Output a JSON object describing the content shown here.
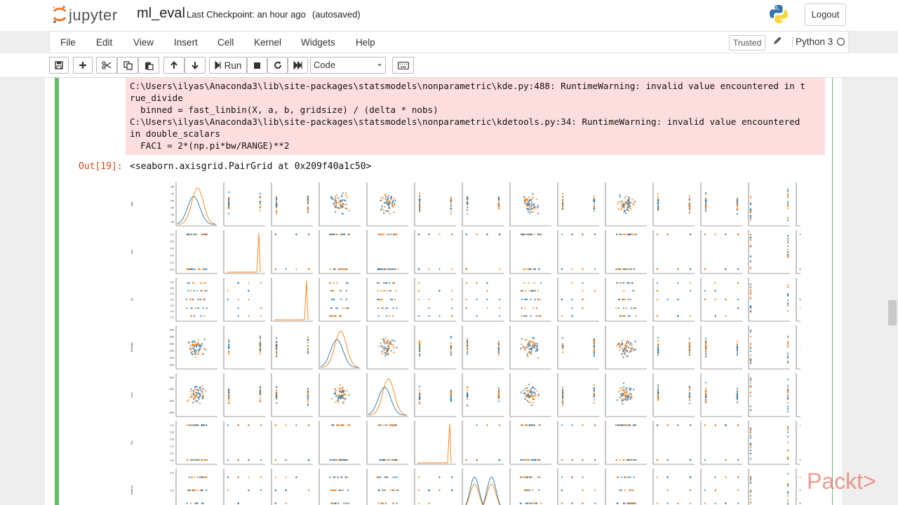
{
  "header": {
    "brand": "jupyter",
    "notebook_name": "ml_eval",
    "checkpoint": "Last Checkpoint: an hour ago",
    "autosave": "(autosaved)",
    "logout": "Logout"
  },
  "menubar": {
    "items": [
      "File",
      "Edit",
      "View",
      "Insert",
      "Cell",
      "Kernel",
      "Widgets",
      "Help"
    ],
    "trusted": "Trusted",
    "kernel": "Python 3"
  },
  "toolbar": {
    "run_label": "Run",
    "cell_type": "Code",
    "buttons": [
      "save-icon",
      "plus-icon",
      "scissors-icon",
      "copy-icon",
      "paste-icon",
      "arrow-up-icon",
      "arrow-down-icon",
      "run-icon",
      "stop-icon",
      "restart-icon",
      "fast-forward-icon",
      "keyboard-icon"
    ]
  },
  "cell": {
    "stderr_lines": [
      "C:\\Users\\ilyas\\Anaconda3\\lib\\site-packages\\statsmodels\\nonparametric\\kde.py:488: RuntimeWarning: invalid value encountered in t",
      "rue_divide",
      "  binned = fast_linbin(X, a, b, gridsize) / (delta * nobs)",
      "C:\\Users\\ilyas\\Anaconda3\\lib\\site-packages\\statsmodels\\nonparametric\\kdetools.py:34: RuntimeWarning: invalid value encountered",
      "in double_scalars",
      "  FAC1 = 2*(np.pi*bw/RANGE)**2"
    ],
    "out_prompt": "Out[19]:",
    "out_text": "<seaborn.axisgrid.PairGrid at 0x209f40a1c50>"
  },
  "chart_data": {
    "type": "scatter",
    "description_kind": "pairgrid",
    "n_cols": 14,
    "n_rows_visible": 7,
    "series": [
      {
        "name": "",
        "color": "#1f77b4"
      },
      {
        "name": "",
        "color": "#ff7f0e"
      }
    ],
    "row_ylabels": [
      "age",
      "sex",
      "cp",
      "trestbps",
      "chol",
      "fbs",
      "restecg"
    ],
    "row_ticks": [
      [
        "80",
        "70",
        "60",
        "50",
        "40",
        "30"
      ],
      [
        "1.0",
        "0.8",
        "0.6",
        "0.4",
        "0.2",
        "0.0"
      ],
      [
        "4.0",
        "3.5",
        "3.0",
        "2.5",
        "2.0",
        "1.5",
        "1.0"
      ],
      [
        "200",
        "180",
        "160",
        "140",
        "120",
        "100"
      ],
      [
        "500",
        "400",
        "300",
        "200"
      ],
      [
        "1.0",
        "0.8",
        "0.6",
        "0.4",
        "0.2",
        "0.0"
      ],
      [
        "2.0",
        "1.5",
        "1.0"
      ]
    ]
  },
  "watermark": "Packt>"
}
